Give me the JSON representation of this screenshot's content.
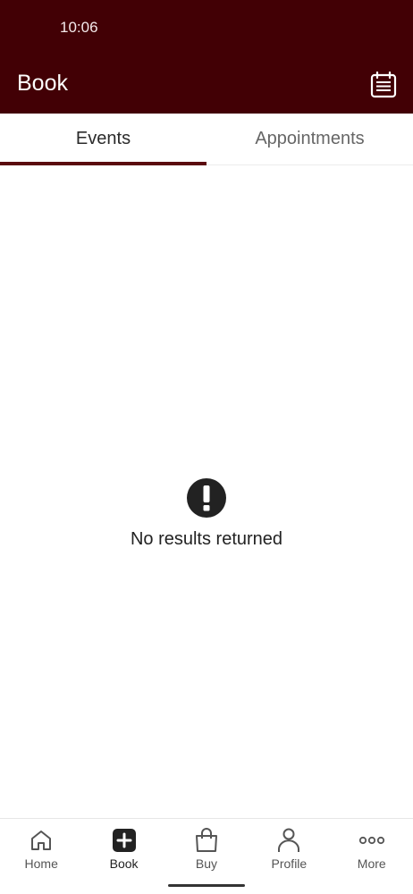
{
  "status_bar": {
    "time": "10:06"
  },
  "header": {
    "title": "Book",
    "calendar_icon": "calendar-icon",
    "background": "#420005"
  },
  "tabs": [
    {
      "label": "Events",
      "active": true
    },
    {
      "label": "Appointments",
      "active": false
    }
  ],
  "empty_state": {
    "icon": "exclamation-circle-icon",
    "message": "No results returned"
  },
  "bottom_nav": {
    "items": [
      {
        "label": "Home",
        "icon": "home-icon",
        "active": false
      },
      {
        "label": "Book",
        "icon": "plus-square-icon",
        "active": true
      },
      {
        "label": "Buy",
        "icon": "shopping-bag-icon",
        "active": false
      },
      {
        "label": "Profile",
        "icon": "person-icon",
        "active": false
      },
      {
        "label": "More",
        "icon": "more-dots-icon",
        "active": false
      }
    ]
  },
  "colors": {
    "accent": "#5a0a0f",
    "header": "#420005"
  }
}
